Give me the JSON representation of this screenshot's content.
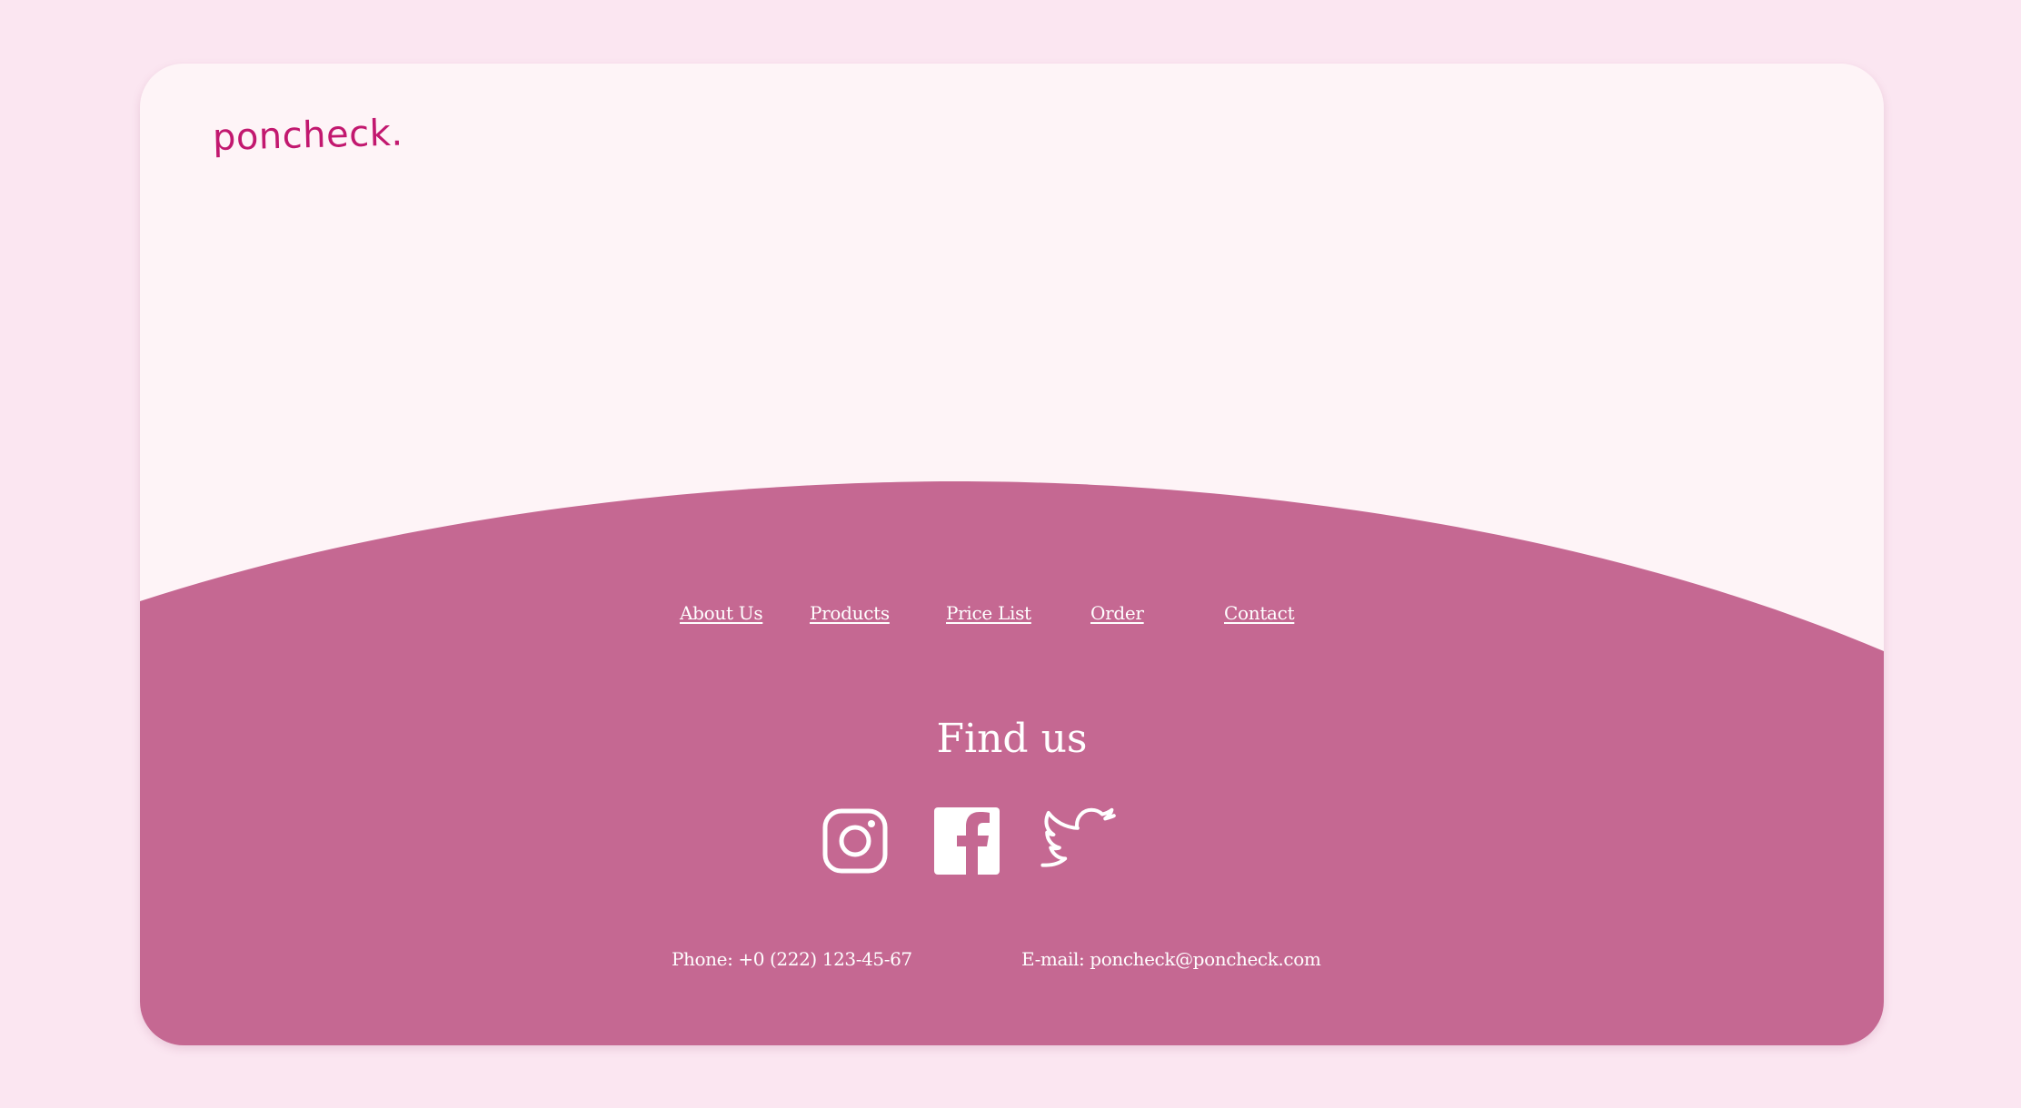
{
  "brand": {
    "logo_text": "poncheck."
  },
  "footer": {
    "nav": [
      {
        "label": "About Us"
      },
      {
        "label": "Products"
      },
      {
        "label": "Price List"
      },
      {
        "label": "Order"
      },
      {
        "label": "Contact"
      }
    ],
    "find_us_title": "Find us",
    "social": [
      {
        "name": "Instagram",
        "icon": "instagram-icon"
      },
      {
        "name": "Facebook",
        "icon": "facebook-icon"
      },
      {
        "name": "Twitter",
        "icon": "twitter-icon"
      }
    ],
    "phone": "Phone: +0 (222) 123-45-67",
    "email": "E-mail: poncheck@poncheck.com"
  },
  "colors": {
    "page_background": "#fbe6f1",
    "card_background": "#fef4f7",
    "footer_background": "#c56892",
    "logo": "#c2186f",
    "footer_text": "#ffffff"
  }
}
